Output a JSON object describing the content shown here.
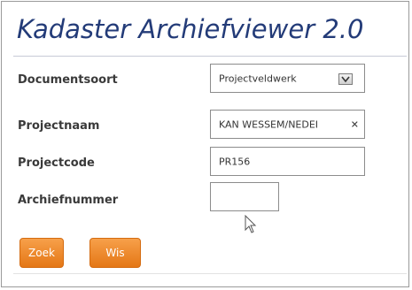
{
  "app": {
    "title": "Kadaster Archiefviewer 2.0"
  },
  "form": {
    "documentsoort": {
      "label": "Documentsoort",
      "value": "Projectveldwerk"
    },
    "projectnaam": {
      "label": "Projectnaam",
      "value": "KAN WESSEM/NEDEI"
    },
    "projectcode": {
      "label": "Projectcode",
      "value": "PR156"
    },
    "archiefnummer": {
      "label": "Archiefnummer",
      "value": ""
    }
  },
  "buttons": {
    "search_label": "Zoek",
    "clear_label": "Wis"
  },
  "icons": {
    "clear": "close-icon",
    "dropdown": "chevron-down-icon",
    "cursor": "mouse-pointer-icon"
  },
  "colors": {
    "title": "#233b78",
    "button": "#ee8a2a"
  }
}
